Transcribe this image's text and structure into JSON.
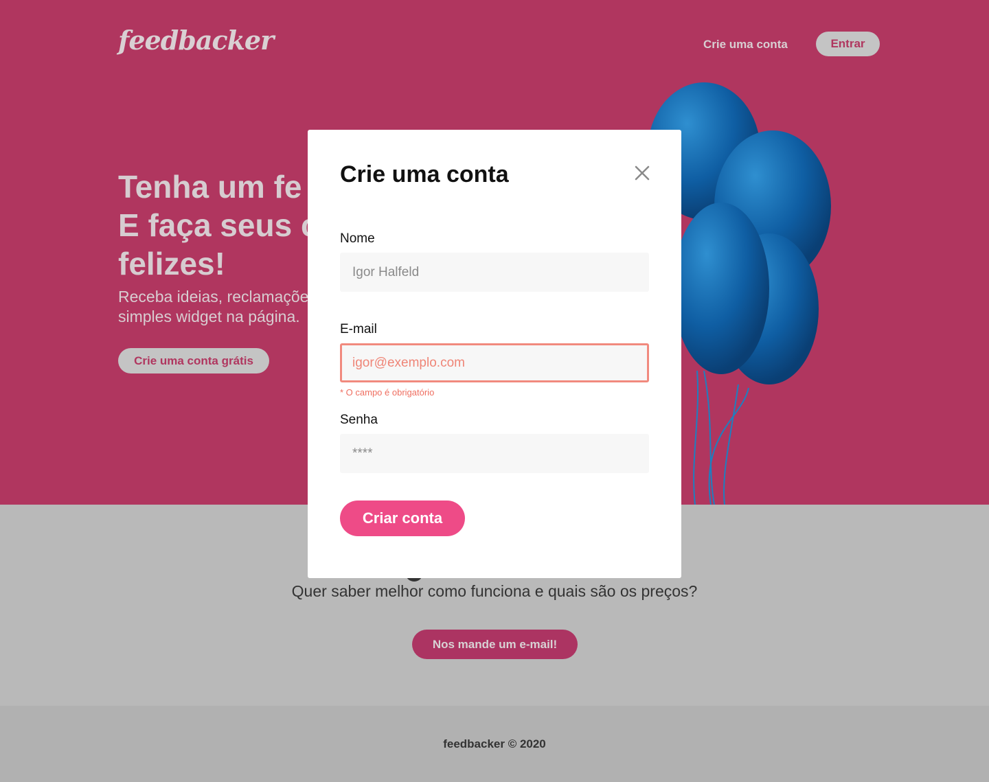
{
  "header": {
    "logo": "feedbacker",
    "nav_link": "Crie uma conta",
    "login_button": "Entrar"
  },
  "hero": {
    "title_lines": [
      "Tenha um fe",
      "E faça seus c",
      "felizes!"
    ],
    "subtitle_lines": [
      "Receba ideias, reclamaçõe",
      "simples widget na página."
    ],
    "cta": "Crie uma conta grátis"
  },
  "info": {
    "question": "Quer saber melhor como funciona e quais são os preços?",
    "button": "Nos mande um e-mail!"
  },
  "footer": {
    "text": "feedbacker © 2020"
  },
  "modal": {
    "title": "Crie uma conta",
    "close_icon": "close-icon",
    "fields": {
      "name": {
        "label": "Nome",
        "placeholder": "Igor Halfeld"
      },
      "email": {
        "label": "E-mail",
        "placeholder": "igor@exemplo.com",
        "error": "* O campo é obrigatório"
      },
      "password": {
        "label": "Senha",
        "placeholder": "****"
      }
    },
    "submit": "Criar conta"
  },
  "colors": {
    "hero_bg": "#b0365f",
    "primary_button": "#ee4b87",
    "error": "#ef6e60",
    "overlay_gray": "#b9b9b9"
  }
}
